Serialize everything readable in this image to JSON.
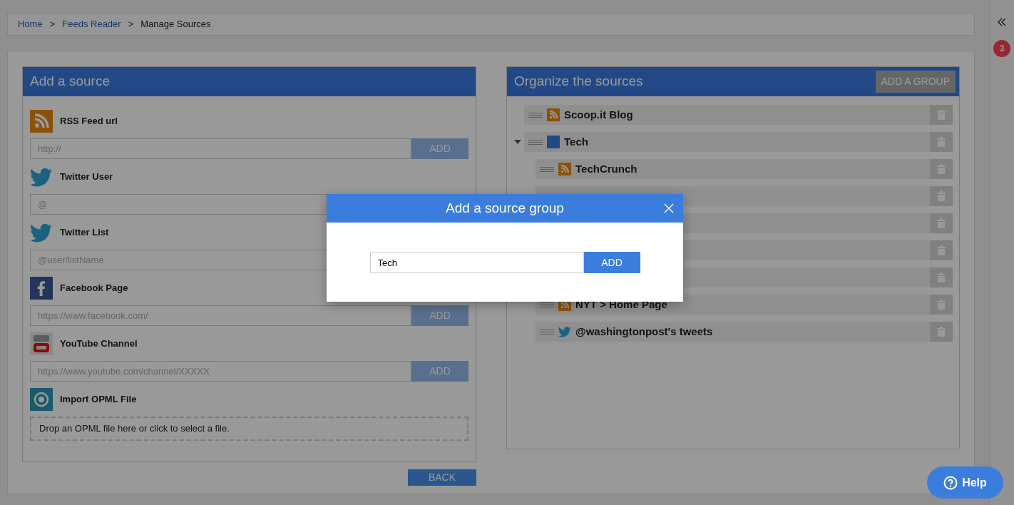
{
  "breadcrumb": [
    {
      "label": "Home",
      "link": true
    },
    {
      "separator": ">",
      "label": "Feeds Reader",
      "link": true
    },
    {
      "separator": ">",
      "label": "Manage Sources",
      "link": false
    }
  ],
  "add_source": {
    "title": "Add a source",
    "sections": [
      {
        "kind": "rss",
        "label": "RSS Feed url",
        "placeholder": "http://",
        "button": "ADD"
      },
      {
        "kind": "twitter",
        "label": "Twitter User",
        "placeholder": "@"
      },
      {
        "kind": "twitter",
        "label": "Twitter List",
        "placeholder": "@user/listName"
      },
      {
        "kind": "facebook",
        "label": "Facebook Page",
        "placeholder": "https://www.facebook.com/",
        "button": "ADD"
      },
      {
        "kind": "youtube",
        "label": "YouTube Channel",
        "placeholder": "https://www.youtube.com/channel/XXXXX",
        "button": "ADD"
      },
      {
        "kind": "opml",
        "label": "Import OPML File",
        "dropzone": "Drop an OPML file here or click to select a file."
      }
    ],
    "back_button": "BACK"
  },
  "organize": {
    "title": "Organize the sources",
    "add_group_button": "ADD A GROUP",
    "items": [
      {
        "kind": "rss",
        "label": "Scoop.it Blog"
      },
      {
        "kind": "group",
        "label": "Tech",
        "expanded": true,
        "children": [
          {
            "kind": "rss",
            "label": "TechCrunch"
          },
          {
            "kind": "covered"
          },
          {
            "kind": "covered"
          },
          {
            "kind": "covered"
          },
          {
            "kind": "covered"
          },
          {
            "kind": "rss",
            "label": "NYT > Home Page"
          },
          {
            "kind": "twitter",
            "label": "@washingtonpost's tweets"
          }
        ]
      }
    ]
  },
  "sidebar": {
    "badge": "3"
  },
  "help_button": "Help",
  "modal": {
    "title": "Add a source group",
    "value": "Tech",
    "button": "ADD"
  }
}
